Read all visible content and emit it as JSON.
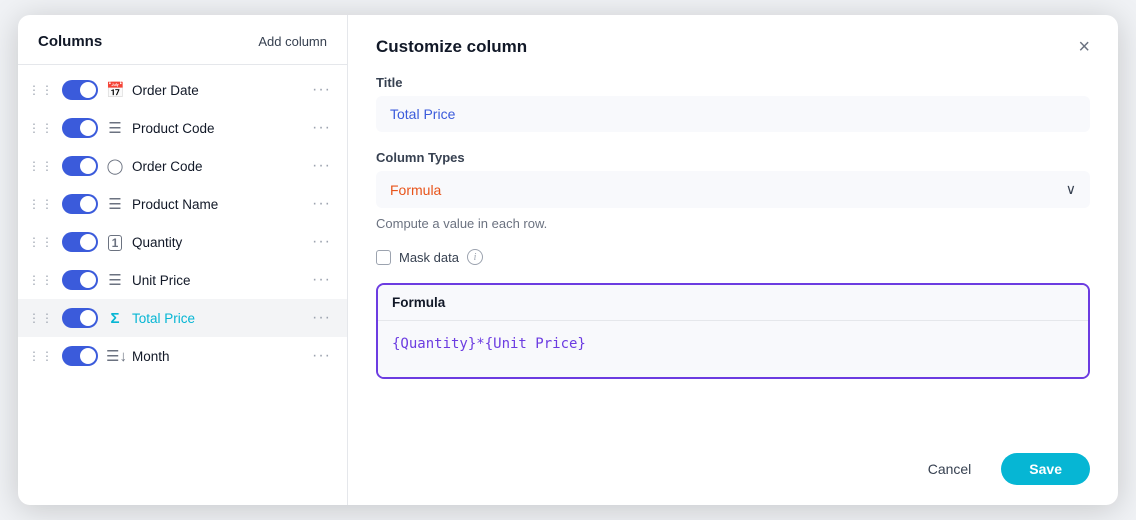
{
  "left_panel": {
    "title": "Columns",
    "add_column_label": "Add column",
    "columns": [
      {
        "id": "order-date",
        "name": "Order Date",
        "icon": "📅",
        "icon_type": "calendar",
        "enabled": true,
        "active": false
      },
      {
        "id": "product-code",
        "name": "Product Code",
        "icon": "≡",
        "icon_type": "list",
        "enabled": true,
        "active": false
      },
      {
        "id": "order-code",
        "name": "Order Code",
        "icon": "🔍",
        "icon_type": "fingerprint",
        "enabled": true,
        "active": false
      },
      {
        "id": "product-name",
        "name": "Product Name",
        "icon": "≡",
        "icon_type": "list",
        "enabled": true,
        "active": false
      },
      {
        "id": "quantity",
        "name": "Quantity",
        "icon": "1",
        "icon_type": "number",
        "enabled": true,
        "active": false
      },
      {
        "id": "unit-price",
        "name": "Unit Price",
        "icon": "≡",
        "icon_type": "list",
        "enabled": true,
        "active": false
      },
      {
        "id": "total-price",
        "name": "Total Price",
        "icon": "Σ",
        "icon_type": "sigma",
        "enabled": true,
        "active": true,
        "highlight": true
      },
      {
        "id": "month",
        "name": "Month",
        "icon": "≡↓",
        "icon_type": "list-sort",
        "enabled": true,
        "active": false
      }
    ]
  },
  "right_panel": {
    "title": "Customize column",
    "title_section_label": "Title",
    "title_value": "Total Price",
    "column_types_label": "Column Types",
    "column_type_value": "Formula",
    "column_type_description": "Compute a value in each row.",
    "mask_label": "Mask data",
    "formula_label": "Formula",
    "formula_value": "{Quantity}*{Unit Price}",
    "cancel_label": "Cancel",
    "save_label": "Save",
    "close_icon": "×"
  }
}
